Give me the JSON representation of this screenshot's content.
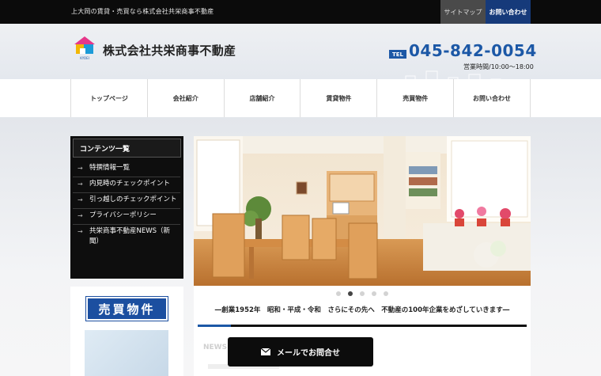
{
  "topbar": {
    "tagline": "上大岡の賃貸・売買なら株式会社共栄商事不動産",
    "sitemap_label": "サイトマップ",
    "contact_label": "お問い合わせ"
  },
  "header": {
    "company_name": "株式会社共栄商事不動産",
    "logo_caption": "KYOEI",
    "tel_badge": "TEL",
    "tel_number": "045-842-0054",
    "hours": "営業時間/10:00～18:00"
  },
  "nav": {
    "items": [
      {
        "label": "トップページ"
      },
      {
        "label": "会社紹介"
      },
      {
        "label": "店舗紹介"
      },
      {
        "label": "賃貸物件"
      },
      {
        "label": "売買物件"
      },
      {
        "label": "お問い合わせ"
      }
    ]
  },
  "sidebar": {
    "title": "コンテンツ一覧",
    "items": [
      {
        "label": "特撰情報一覧"
      },
      {
        "label": "内見時のチェックポイント"
      },
      {
        "label": "引っ越しのチェックポイント"
      },
      {
        "label": "プライバシーポリシー"
      },
      {
        "label": "共栄商事不動産NEWS（新聞）"
      }
    ],
    "banner_label": "売買物件"
  },
  "slider": {
    "image": "living-room-kitchen-photo",
    "dot_count": 5,
    "active_dot": 1,
    "caption": "―創業1952年　昭和・平成・令和　さらにその先へ　不動産の100年企業をめざしていきます―",
    "progress": 0.1
  },
  "news": {
    "heading": "NEWS"
  },
  "mail_button": {
    "label": "メールでお問合せ",
    "icon": "envelope-icon"
  },
  "colors": {
    "brand_blue": "#1c58a6",
    "topbar": "#0b0b0b",
    "sidebar": "#0e0e0e"
  }
}
